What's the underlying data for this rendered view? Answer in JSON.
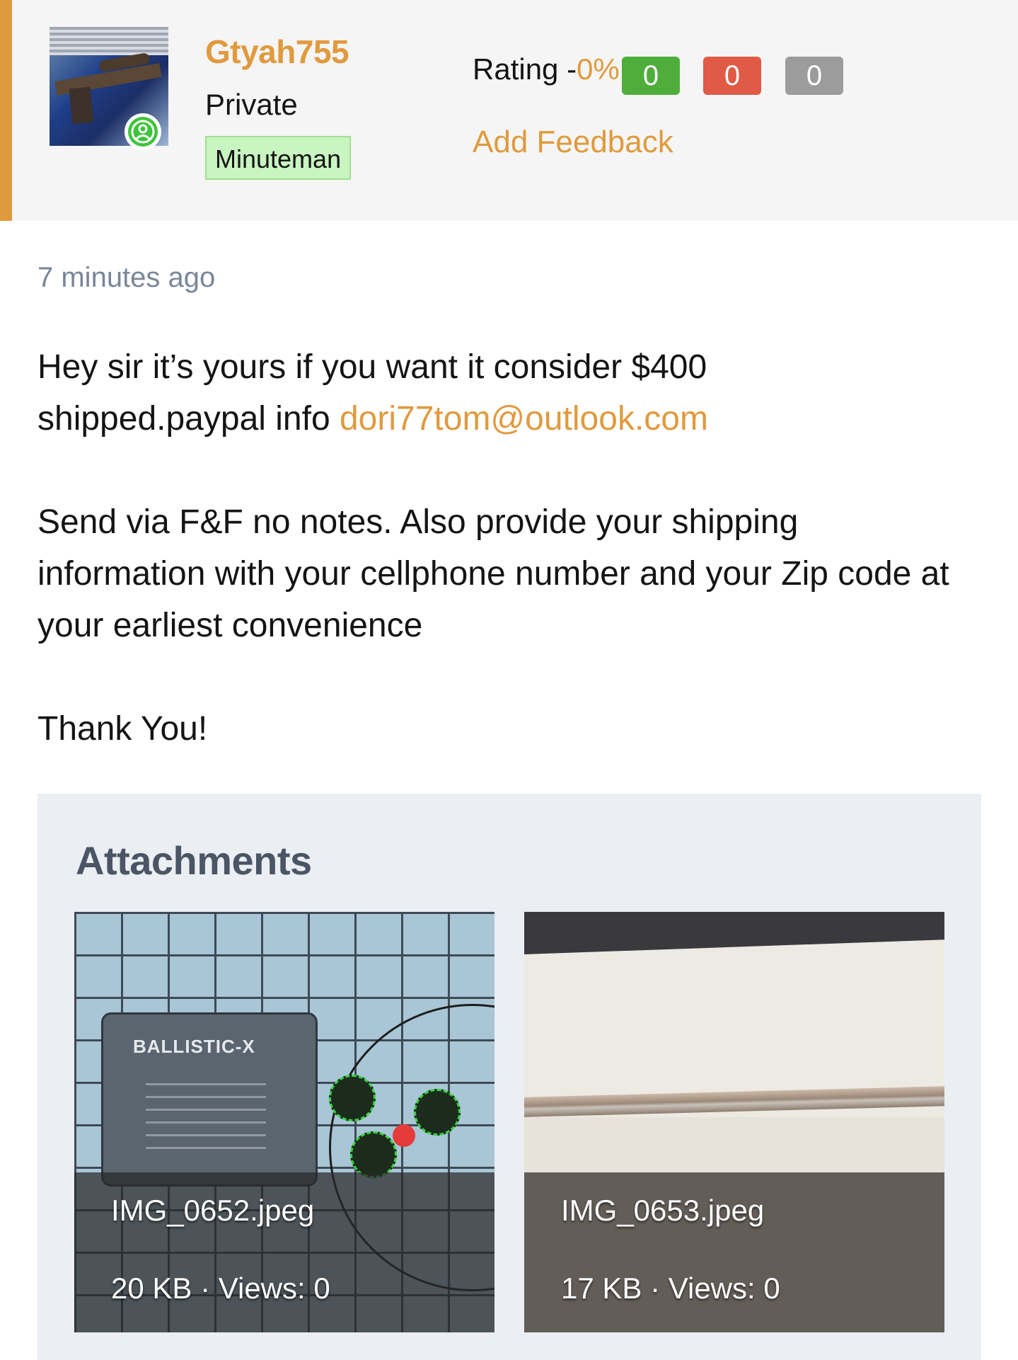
{
  "user": {
    "username": "Gtyah755",
    "rank": "Private",
    "title_badge": "Minuteman",
    "online_status_icon": "user-circle-icon"
  },
  "feedback": {
    "rating_label": "Rating -",
    "rating_percent": "0%",
    "positive": "0",
    "negative": "0",
    "neutral": "0",
    "add_feedback": "Add Feedback"
  },
  "post": {
    "timestamp": "7 minutes ago",
    "line1": "Hey sir it’s yours if you want it consider $400",
    "line2_prefix": "shipped.paypal info ",
    "email": "dori77tom@outlook.com",
    "para2": "Send via F&F no notes. Also provide your shipping information with your cellphone number and your Zip code at your earliest convenience",
    "closing": "Thank You!"
  },
  "attachments": {
    "title": "Attachments",
    "items": [
      {
        "name": "IMG_0652.jpeg",
        "meta": "20 KB · Views: 0",
        "thumb_label": "BALLISTIC-X"
      },
      {
        "name": "IMG_0653.jpeg",
        "meta": "17 KB · Views: 0"
      }
    ]
  },
  "colors": {
    "accent": "#e09a3e",
    "positive": "#4fae3b",
    "negative": "#e05a45",
    "neutral": "#9c9c9c",
    "badge_bg": "#c9f5c1"
  }
}
